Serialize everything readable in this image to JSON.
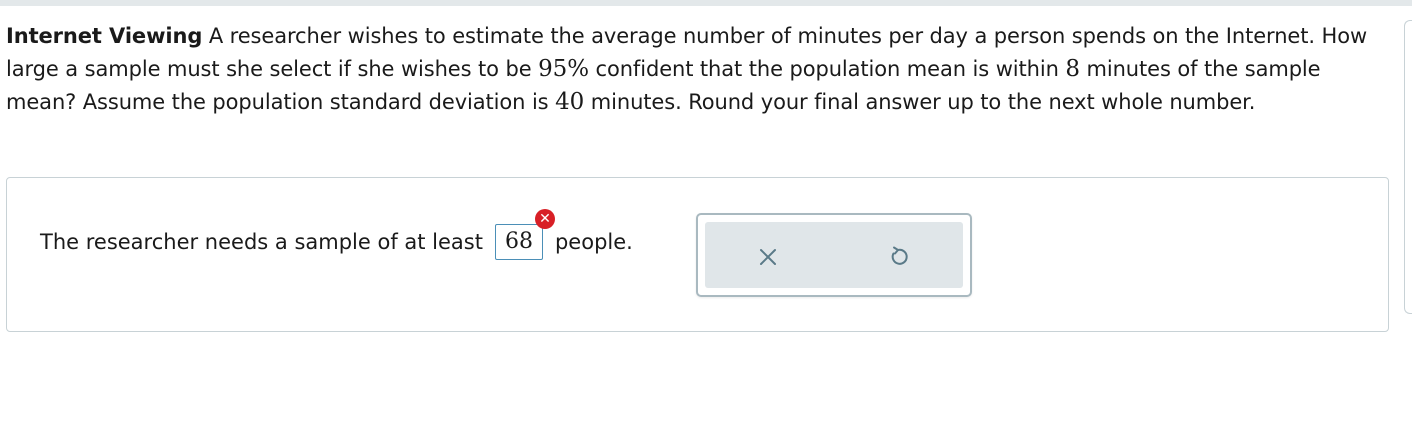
{
  "question": {
    "title": "Internet Viewing",
    "text_1": " A researcher wishes to estimate the average number of minutes per day a person spends on the Internet. How large a sample must she select if she wishes to be ",
    "confidence": "95%",
    "text_2": " confident that the population mean is within ",
    "margin": "8",
    "text_3": " minutes of the sample mean? Assume the population standard deviation is ",
    "sigma": "40",
    "text_4": " minutes. Round your final answer up to the next whole number."
  },
  "answer": {
    "prefix": "The researcher needs a sample of at least",
    "value": "68",
    "suffix": "people.",
    "status_icon": "wrong-x-icon",
    "status_symbol": "✕"
  },
  "actions": {
    "clear_icon": "close-icon",
    "undo_icon": "undo-icon"
  },
  "colors": {
    "wrong": "#d81f26",
    "field_border": "#4b8fb7",
    "panel_bg": "#e0e6e9",
    "icon": "#5a7a88"
  }
}
